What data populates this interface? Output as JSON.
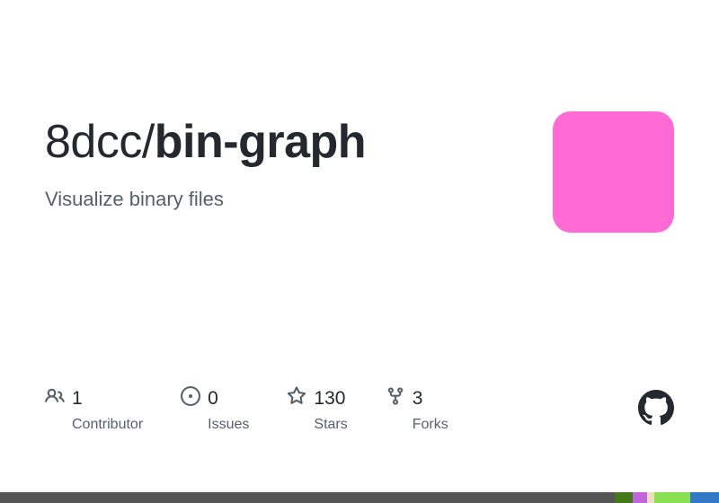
{
  "title": {
    "owner": "8dcc",
    "slash": "/",
    "repo": "bin-graph"
  },
  "description": "Visualize binary files",
  "thumbnail": {
    "color": "#ff6ad5"
  },
  "stats": {
    "contributors": {
      "count": "1",
      "label": "Contributor"
    },
    "issues": {
      "count": "0",
      "label": "Issues"
    },
    "stars": {
      "count": "130",
      "label": "Stars"
    },
    "forks": {
      "count": "3",
      "label": "Forks"
    }
  }
}
